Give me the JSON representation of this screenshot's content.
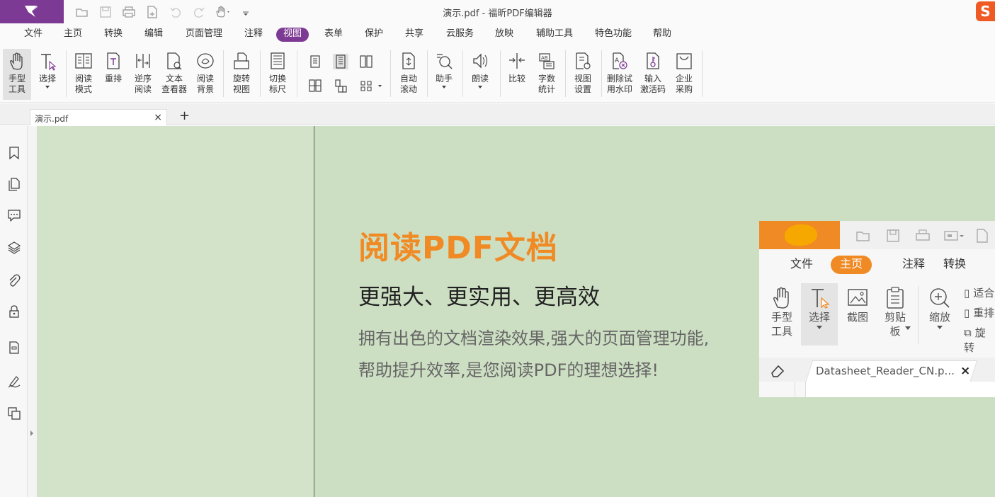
{
  "window": {
    "title": "演示.pdf - 福昕PDF编辑器"
  },
  "ime_badge": "S",
  "colors": {
    "accent": "#7d3a94",
    "orange": "#f08a24",
    "page_bg": "#cddfc3"
  },
  "quick_access": [
    "open-icon",
    "save-icon",
    "print-icon",
    "new-doc-icon",
    "undo-icon",
    "redo-icon",
    "hand-icon",
    "customize-icon"
  ],
  "menu": {
    "items": [
      "文件",
      "主页",
      "转换",
      "编辑",
      "页面管理",
      "注释",
      "视图",
      "表单",
      "保护",
      "共享",
      "云服务",
      "放映",
      "辅助工具",
      "特色功能",
      "帮助"
    ],
    "active": "视图"
  },
  "ribbon": {
    "hand": "手型\n工具",
    "select": "选择",
    "read_mode": "阅读\n模式",
    "reflow": "重排",
    "reverse": "逆序\n阅读",
    "text_viewer": "文本\n查看器",
    "read_bg": "阅读\n背景",
    "rotate": "旋转\n视图",
    "ruler": "切换\n标尺",
    "auto_scroll": "自动\n滚动",
    "assistant": "助手",
    "read_aloud": "朗读",
    "compare": "比较",
    "word_count": "字数\n统计",
    "view_settings": "视图\n设置",
    "remove_watermark": "删除试\n用水印",
    "activation": "输入\n激活码",
    "enterprise": "企业\n采购"
  },
  "tabs": {
    "doc": "演示.pdf",
    "close": "×",
    "new": "+"
  },
  "sidebar": [
    "bookmark-icon",
    "pages-icon",
    "comment-icon",
    "layers-icon",
    "attachment-icon",
    "security-icon",
    "form-icon",
    "signature-icon",
    "compare-pages-icon"
  ],
  "document": {
    "heading": "阅读PDF文档",
    "subheading": "更强大、更实用、更高效",
    "desc_line1": "拥有出色的文档渲染效果,强大的页面管理功能,",
    "desc_line2": "帮助提升效率,是您阅读PDF的理想选择!"
  },
  "embedded": {
    "menu": [
      "文件",
      "主页",
      "注释",
      "转换"
    ],
    "active": "主页",
    "tools": {
      "hand": "手型\n工具",
      "select": "选择",
      "screenshot": "截图",
      "clipboard": "剪贴\n板",
      "zoom": "缩放"
    },
    "side_items": [
      "适合",
      "重排",
      "旋转"
    ],
    "tab_label": "Datasheet_Reader_CN.p...",
    "tab_close": "×"
  }
}
